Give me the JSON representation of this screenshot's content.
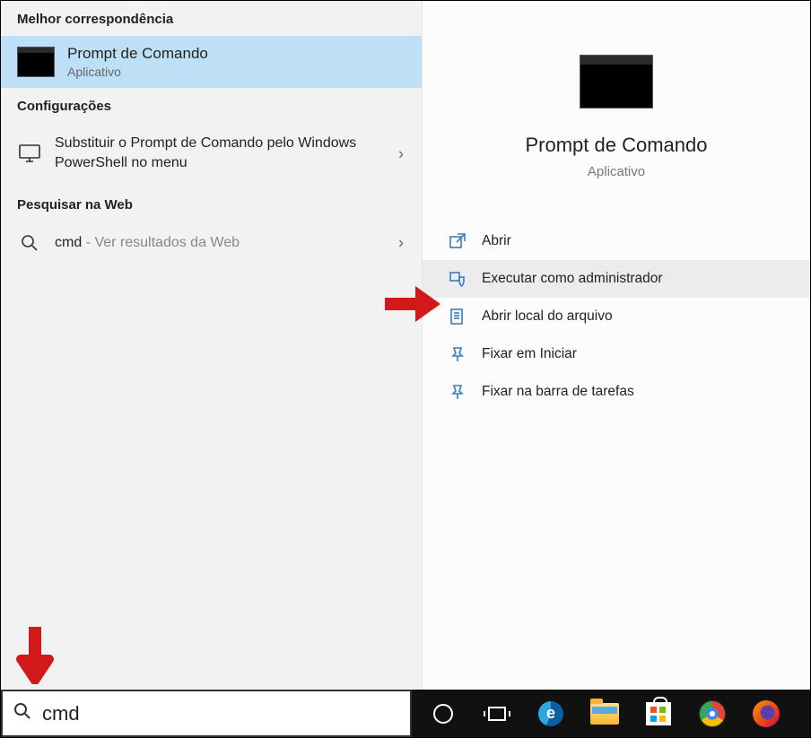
{
  "left": {
    "best_match_header": "Melhor correspondência",
    "best_match": {
      "title": "Prompt de Comando",
      "subtitle": "Aplicativo"
    },
    "settings_header": "Configurações",
    "settings_item": "Substituir o Prompt de Comando pelo Windows PowerShell no menu",
    "web_header": "Pesquisar na Web",
    "web_item_term": "cmd",
    "web_item_hint": " - Ver resultados da Web"
  },
  "right": {
    "title": "Prompt de Comando",
    "subtitle": "Aplicativo",
    "actions": {
      "open": "Abrir",
      "run_admin": "Executar como administrador",
      "open_location": "Abrir local do arquivo",
      "pin_start": "Fixar em Iniciar",
      "pin_taskbar": "Fixar na barra de tarefas"
    }
  },
  "search": {
    "value": "cmd",
    "placeholder": ""
  },
  "taskbar": {
    "cortana": "cortana-circle-icon",
    "taskview": "task-view-icon",
    "edge": "edge-icon",
    "explorer": "file-explorer-icon",
    "store": "microsoft-store-icon",
    "chrome": "chrome-icon",
    "firefox": "firefox-icon"
  }
}
